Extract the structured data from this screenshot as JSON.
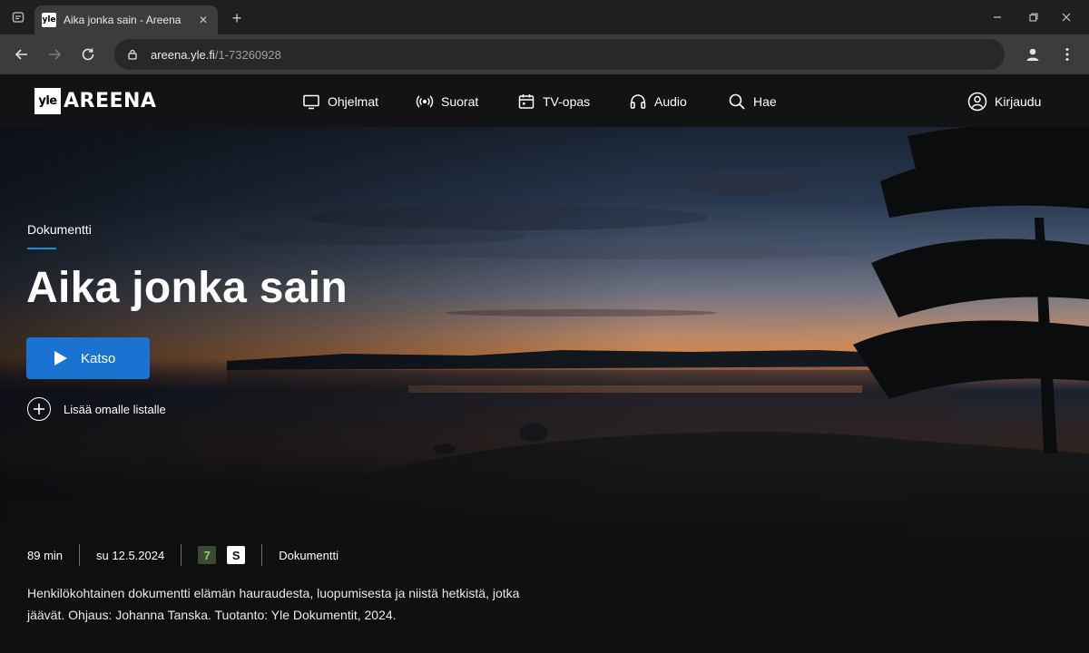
{
  "browser": {
    "tab_title": "Aika jonka sain - Areena",
    "favicon_text": "yle",
    "url_host": "areena.yle.fi",
    "url_path": "/1-73260928"
  },
  "site": {
    "logo_yle": "yle",
    "logo_areena": "AREENA",
    "nav": [
      {
        "label": "Ohjelmat",
        "icon": "tv-icon"
      },
      {
        "label": "Suorat",
        "icon": "broadcast-icon"
      },
      {
        "label": "TV-opas",
        "icon": "calendar-icon"
      },
      {
        "label": "Audio",
        "icon": "headphones-icon"
      },
      {
        "label": "Hae",
        "icon": "search-icon"
      }
    ],
    "login_label": "Kirjaudu"
  },
  "program": {
    "genre": "Dokumentti",
    "title": "Aika jonka sain",
    "play_label": "Katso",
    "add_to_list_label": "Lisää omalle listalle",
    "duration": "89 min",
    "date": "su 12.5.2024",
    "age_rating": "7",
    "rating_s": "S",
    "category": "Dokumentti",
    "description": "Henkilökohtainen dokumentti elämän hauraudesta, luopumisesta ja niistä hetkistä, jotka jäävät. Ohjaus: Johanna Tanska. Tuotanto: Yle Dokumentit, 2024."
  },
  "colors": {
    "accent": "#1a73d1",
    "underline": "#1f8bd9",
    "rating_green": "#9bd067"
  }
}
